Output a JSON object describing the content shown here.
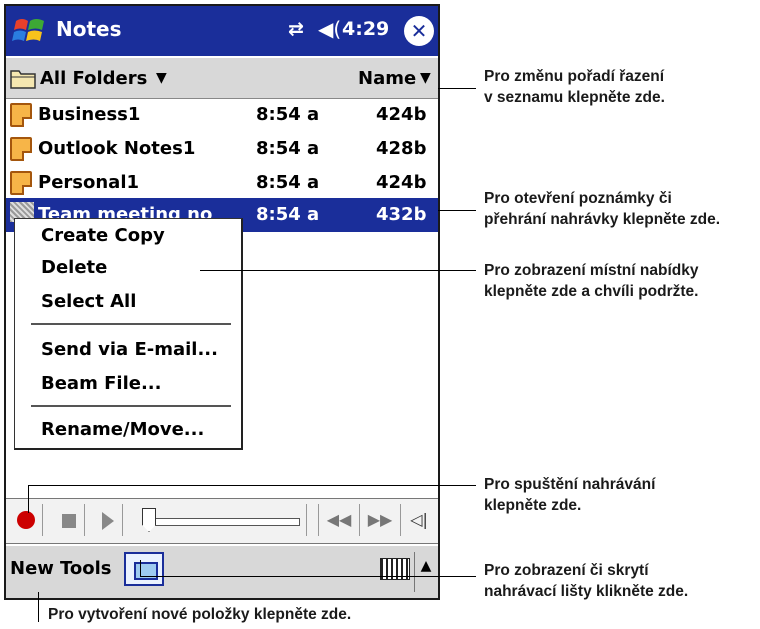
{
  "titlebar": {
    "app_title": "Notes",
    "sync_icon": "⇄",
    "volume_icon": "◀(",
    "time": "4:29",
    "close_label": "✕"
  },
  "folderbar": {
    "folder_label": "All Folders",
    "sort_label": "Name"
  },
  "notes": [
    {
      "name": "Business1",
      "time": "8:54 a",
      "size": "424b"
    },
    {
      "name": "Outlook Notes1",
      "time": "8:54 a",
      "size": "428b"
    },
    {
      "name": "Personal1",
      "time": "8:54 a",
      "size": "424b"
    },
    {
      "name": "Team meeting no",
      "time": "8:54 a",
      "size": "432b"
    }
  ],
  "context_menu": {
    "create_copy": "Create Copy",
    "delete": "Delete",
    "select_all": "Select All",
    "send_email": "Send via E-mail...",
    "beam_file": "Beam File...",
    "rename_move": "Rename/Move..."
  },
  "recording_bar": {
    "prev_label": "◀◀",
    "next_label": "▶▶",
    "volume_label": "◁|"
  },
  "menubar": {
    "new_label": "New",
    "tools_label": "Tools",
    "sip_label": "▲"
  },
  "annotations": {
    "sort": [
      "Pro změnu pořadí řazení",
      "v seznamu klepněte zde."
    ],
    "open": [
      "Pro otevření poznámky či",
      "přehrání nahrávky klepněte zde."
    ],
    "context": [
      "Pro zobrazení místní nabídky",
      "klepněte zde a chvíli podržte."
    ],
    "record": [
      "Pro spuštění nahrávání",
      "klepněte zde."
    ],
    "toggle": [
      "Pro zobrazení či skrytí",
      "nahrávací lišty klikněte zde."
    ],
    "new": "Pro vytvoření nové položky klepněte zde."
  },
  "colors": {
    "titlebar": "#1a2e9a",
    "selection": "#1a2e9a",
    "record_button": "#cc0000"
  }
}
